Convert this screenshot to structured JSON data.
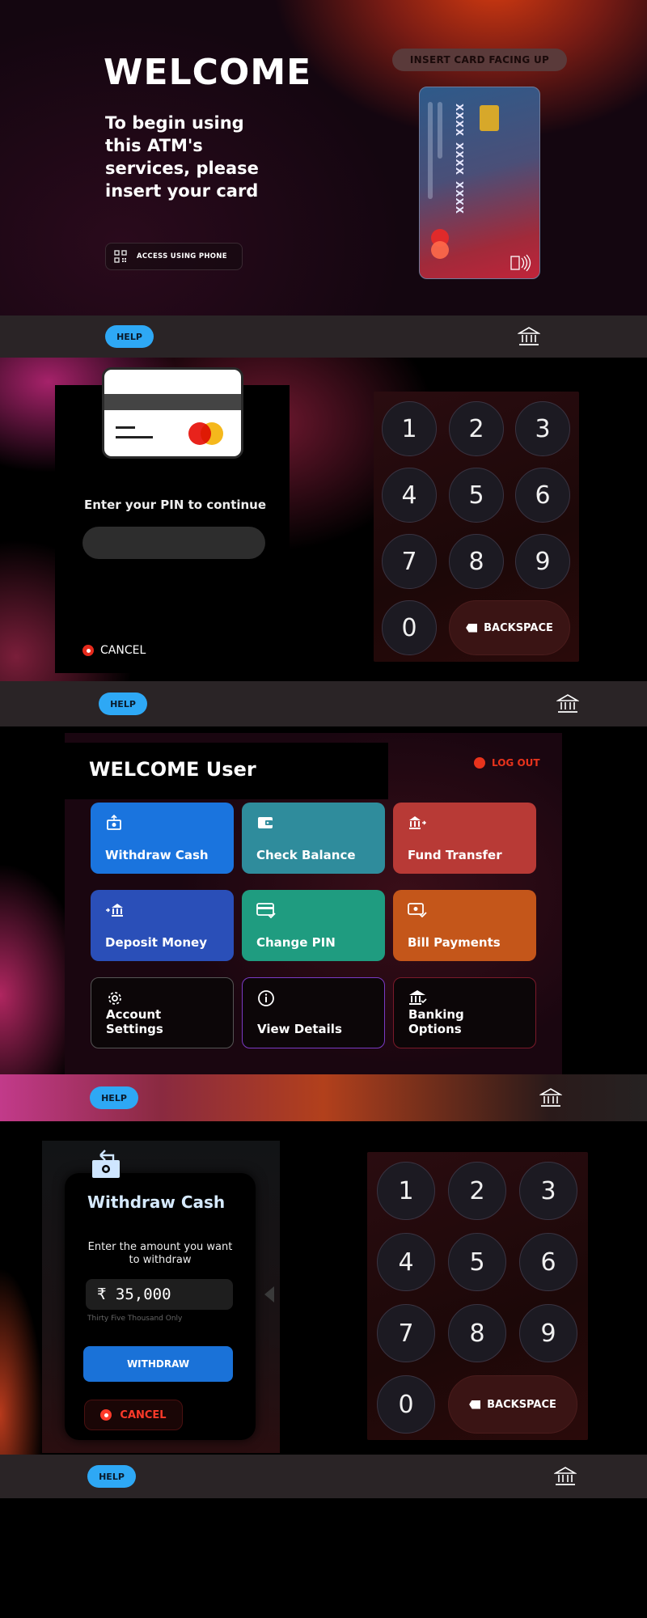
{
  "screen_welcome": {
    "title": "WELCOME",
    "subtitle": "To begin using this ATM's services, please insert your card",
    "phone_access_label": "ACCESS USING PHONE",
    "insert_badge": "INSERT CARD FACING UP",
    "card_numbers": [
      "XXXX",
      "XXXX",
      "XXXX"
    ]
  },
  "help_bars": [
    {
      "help_label": "HELP",
      "icon": "bank-icon"
    },
    {
      "help_label": "HELP",
      "icon": "bank-icon"
    },
    {
      "help_label": "HELP",
      "icon": "bank-icon"
    },
    {
      "help_label": "HELP",
      "icon": "bank-icon"
    }
  ],
  "screen_pin": {
    "prompt": "Enter your PIN to continue",
    "cancel_label": "CANCEL",
    "keys": [
      "1",
      "2",
      "3",
      "4",
      "5",
      "6",
      "7",
      "8",
      "9",
      "0"
    ],
    "backspace_label": "BACKSPACE"
  },
  "screen_menu": {
    "title": "WELCOME  User",
    "logout_label": "LOG OUT",
    "tiles": [
      {
        "label": "Withdraw Cash",
        "icon": "cash-withdraw-icon",
        "color": "#1a74de"
      },
      {
        "label": "Check Balance",
        "icon": "wallet-icon",
        "color": "#2f8c9c"
      },
      {
        "label": "Fund Transfer",
        "icon": "bank-transfer-icon",
        "color": "#b83a36"
      },
      {
        "label": "Deposit Money",
        "icon": "deposit-icon",
        "color": "#2a4fb8"
      },
      {
        "label": "Change PIN",
        "icon": "card-pin-icon",
        "color": "#1f9c80"
      },
      {
        "label": "Bill Payments",
        "icon": "bill-icon",
        "color": "#c4561a"
      },
      {
        "label": "Account Settings",
        "icon": "gear-icon",
        "color": "#555555"
      },
      {
        "label": "View Details",
        "icon": "info-icon",
        "color": "#7a3ac4"
      },
      {
        "label": "Banking Options",
        "icon": "bank-options-icon",
        "color": "#7a1a2a"
      }
    ]
  },
  "screen_withdraw": {
    "title": "Withdraw Cash",
    "description": "Enter the amount you want to withdraw",
    "amount": "₹ 35,000",
    "amount_words": "Thirty Five Thousand Only",
    "withdraw_label": "WITHDRAW",
    "cancel_label": "CANCEL",
    "keys": [
      "1",
      "2",
      "3",
      "4",
      "5",
      "6",
      "7",
      "8",
      "9",
      "0"
    ],
    "backspace_label": "BACKSPACE"
  }
}
